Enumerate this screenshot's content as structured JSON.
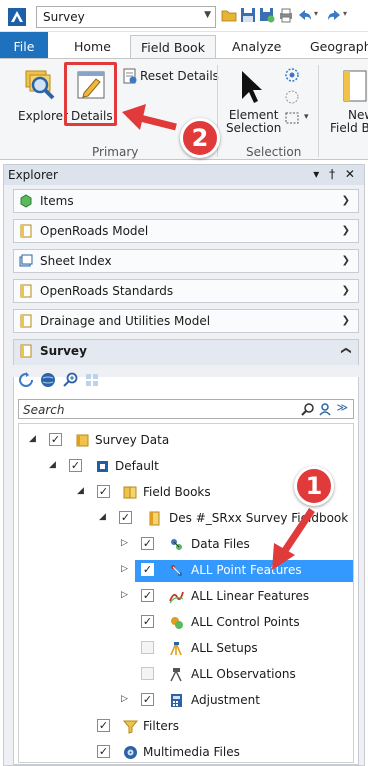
{
  "titlebar": {
    "workset": "Survey"
  },
  "tabs": [
    {
      "label": "File"
    },
    {
      "label": "Home"
    },
    {
      "label": "Field Book"
    },
    {
      "label": "Analyze"
    },
    {
      "label": "Geographi"
    }
  ],
  "ribbon": {
    "explorer": "Explorer",
    "details": "Details",
    "reset_details": "Reset Details",
    "element_selection_1": "Element",
    "element_selection_2": "Selection",
    "new_field_book_1": "New",
    "new_field_book_2": "Field B",
    "group_primary": "Primary",
    "group_selection": "Selection"
  },
  "panel": {
    "title": "Explorer",
    "controls": "▾ † ✕",
    "sections": [
      {
        "label": "Items"
      },
      {
        "label": "OpenRoads Model"
      },
      {
        "label": "Sheet Index"
      },
      {
        "label": "OpenRoads Standards"
      },
      {
        "label": "Drainage and Utilities Model"
      },
      {
        "label": "Survey"
      }
    ],
    "search_placeholder": "Search"
  },
  "tree": [
    {
      "label": "Survey Data",
      "expander": "◢",
      "checked": true
    },
    {
      "label": "Default",
      "expander": "◢",
      "checked": true
    },
    {
      "label": "Field Books",
      "expander": "◢",
      "checked": true
    },
    {
      "label": "Des #_SRxx Survey Fieldbook",
      "expander": "◢",
      "checked": true
    },
    {
      "label": "Data Files",
      "expander": "▷",
      "checked": true
    },
    {
      "label": "ALL Point Features",
      "expander": "▷",
      "checked": true,
      "selected": true
    },
    {
      "label": "ALL Linear Features",
      "expander": "▷",
      "checked": true
    },
    {
      "label": "ALL Control Points",
      "expander": "",
      "checked": true
    },
    {
      "label": "ALL Setups",
      "expander": "",
      "checked": false
    },
    {
      "label": "ALL Observations",
      "expander": "",
      "checked": false
    },
    {
      "label": "Adjustment",
      "expander": "▷",
      "checked": true
    },
    {
      "label": "Filters",
      "expander": "",
      "checked": true
    },
    {
      "label": "Multimedia Files",
      "expander": "",
      "checked": true
    }
  ],
  "callouts": {
    "one": "1",
    "two": "2"
  },
  "colors": {
    "accent": "#1e72bd",
    "selection": "#3399ff",
    "callout": "#e03a3a"
  },
  "icons": [
    "app-logo-icon",
    "open-folder-icon",
    "save-icon",
    "save-settings-icon",
    "print-icon",
    "undo-icon",
    "redo-icon",
    "explorer-icon",
    "details-icon",
    "reset-details-icon",
    "element-selection-icon",
    "selection-mode-icon",
    "new-field-book-icon",
    "items-icon",
    "file-icon",
    "sheet-index-icon",
    "survey-icon",
    "search-icon",
    "filter-icon",
    "chevron-down-icon",
    "chevron-up-icon"
  ]
}
